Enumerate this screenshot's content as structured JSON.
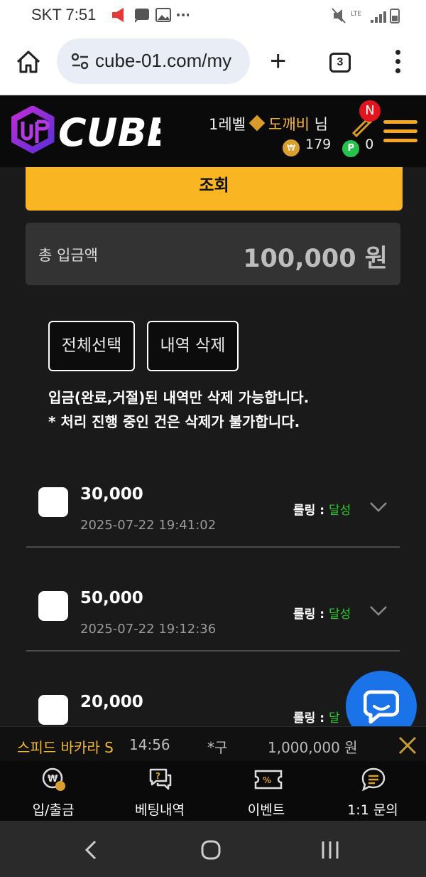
{
  "status_bar": {
    "carrier_time": "SKT 7:51",
    "icons": "▶■□ ···",
    "right_icons": "LTE ↑↓"
  },
  "browser": {
    "url": "cube-01.com/my",
    "tab_count": "3"
  },
  "header": {
    "logo_text": "CUBE",
    "level": "1레벨",
    "user_name": "도깨비",
    "suffix": "님",
    "notification_badge": "N",
    "coin_symbol": "₩",
    "coin_balance": "179",
    "point_symbol": "P",
    "point_balance": "0"
  },
  "search_button": "조회",
  "total": {
    "label": "총 입금액",
    "amount": "100,000 원"
  },
  "actions": {
    "select_all": "전체선택",
    "delete_history": "내역 삭제"
  },
  "notice": {
    "line1": "입금(완료,거절)된 내역만 삭제 가능합니다.",
    "line2": "* 처리 진행 중인 건은 삭제가 불가합니다."
  },
  "deposits": [
    {
      "amount": "30,000",
      "datetime": "2025-07-22 19:41:02",
      "rolling_label": "롤링 :",
      "rolling_status": "달성"
    },
    {
      "amount": "50,000",
      "datetime": "2025-07-22 19:12:36",
      "rolling_label": "롤링 :",
      "rolling_status": "달성"
    },
    {
      "amount": "20,000",
      "datetime": "",
      "rolling_label": "롤링 :",
      "rolling_status": "달"
    }
  ],
  "ticker": {
    "game": "스피드 바카라 S",
    "time": "14:56",
    "user": "*구",
    "amount": "1,000,000 원"
  },
  "bottom_nav": [
    {
      "label": "입/출금",
      "icon": "wallet-icon"
    },
    {
      "label": "베팅내역",
      "icon": "chat-question-icon"
    },
    {
      "label": "이벤트",
      "icon": "ticket-icon"
    },
    {
      "label": "1:1 문의",
      "icon": "message-icon"
    }
  ],
  "colors": {
    "accent": "#f9b522",
    "success": "#29c82a",
    "badge": "#e4141e",
    "chat": "#1a73e8"
  }
}
